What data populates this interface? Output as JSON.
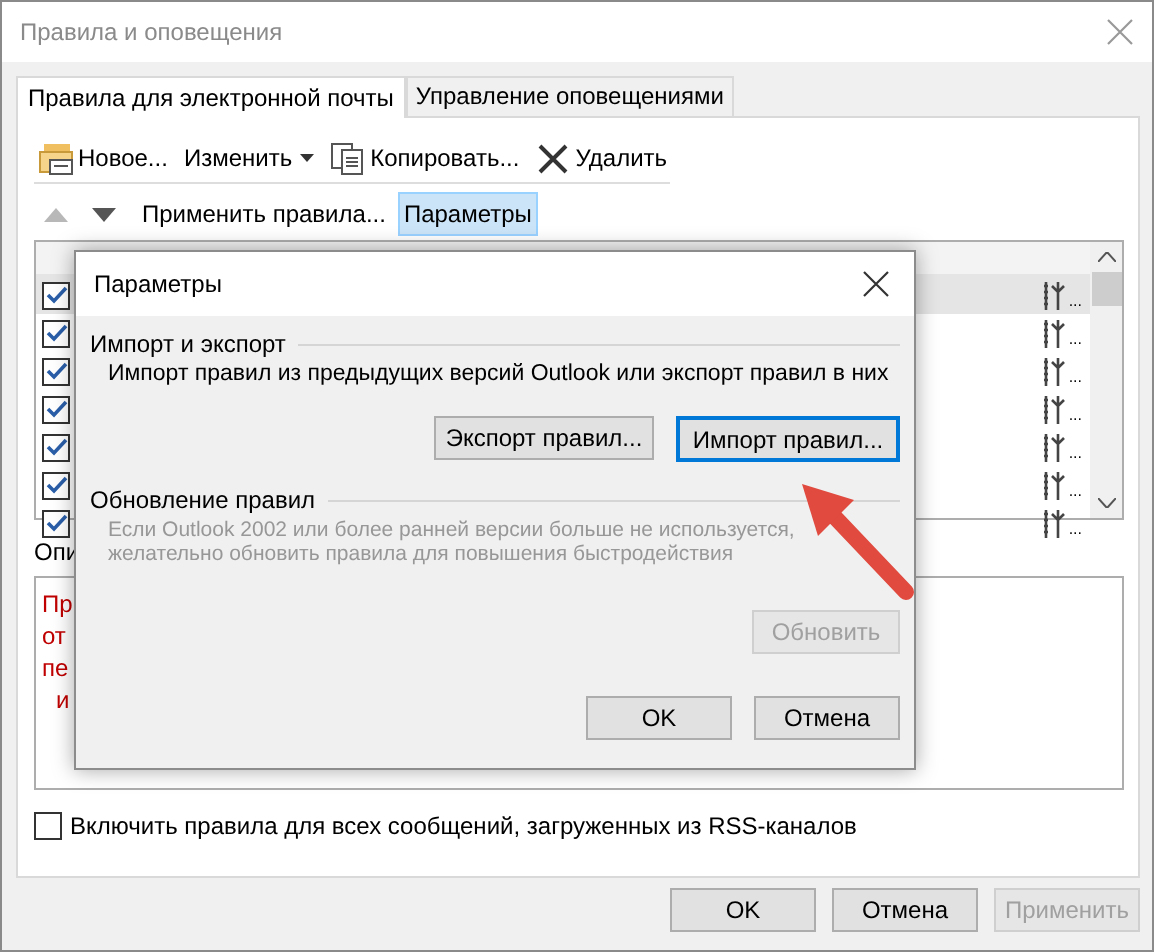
{
  "window": {
    "title": "Правила и оповещения"
  },
  "tabs": [
    {
      "label": "Правила для электронной почты",
      "selected": true
    },
    {
      "label": "Управление оповещениями",
      "selected": false
    }
  ],
  "toolbar": [
    {
      "label": "Новое...",
      "kind": "new"
    },
    {
      "label": "Изменить",
      "kind": "dropdown"
    },
    {
      "label": "Копировать...",
      "kind": "copy"
    },
    {
      "label": "Удалить",
      "kind": "delete"
    }
  ],
  "move_buttons": [
    {
      "kind": "up",
      "disabled": true
    },
    {
      "kind": "down",
      "disabled": false
    }
  ],
  "secondary_toolbar": [
    {
      "label": "Применить правила...",
      "selected": false
    },
    {
      "label": "Параметры",
      "selected": true
    }
  ],
  "rules": [
    {
      "checked": true,
      "selected": true,
      "action": "..."
    },
    {
      "checked": true,
      "selected": false,
      "action": "..."
    },
    {
      "checked": true,
      "selected": false,
      "action": "..."
    },
    {
      "checked": true,
      "selected": false,
      "action": "..."
    },
    {
      "checked": true,
      "selected": false,
      "action": "..."
    },
    {
      "checked": true,
      "selected": false,
      "action": "..."
    },
    {
      "checked": true,
      "selected": false,
      "action": "..."
    }
  ],
  "description": {
    "label": "Опи",
    "lines": [
      {
        "text": "Пр",
        "indented": false
      },
      {
        "text": "от",
        "indented": false
      },
      {
        "text": "пе",
        "indented": false
      },
      {
        "text": "и",
        "indented": true
      }
    ]
  },
  "rss_checkbox": {
    "label": "Включить правила для всех сообщений, загруженных из RSS-каналов",
    "checked": false
  },
  "buttons": [
    {
      "label": "OK",
      "disabled": false
    },
    {
      "label": "Отмена",
      "disabled": false
    },
    {
      "label": "Применить",
      "disabled": true
    }
  ],
  "dialog": {
    "title": "Параметры",
    "sections": [
      {
        "heading": "Импорт и экспорт",
        "text": "Импорт правил из предыдущих версий Outlook или экспорт правил в них",
        "disabled": false,
        "buttons": [
          {
            "label": "Экспорт правил...",
            "disabled": false,
            "focused": false
          },
          {
            "label": "Импорт правил...",
            "disabled": false,
            "focused": true
          }
        ]
      },
      {
        "heading": "Обновление правил",
        "text": "Если Outlook 2002 или более ранней версии больше не используется, желательно обновить правила для повышения быстродействия",
        "disabled": true,
        "buttons": [
          {
            "label": "Обновить",
            "disabled": true,
            "focused": false
          }
        ]
      }
    ],
    "buttons": [
      {
        "label": "OK",
        "disabled": false,
        "focused": false
      },
      {
        "label": "Отмена",
        "disabled": false,
        "focused": false
      }
    ]
  }
}
